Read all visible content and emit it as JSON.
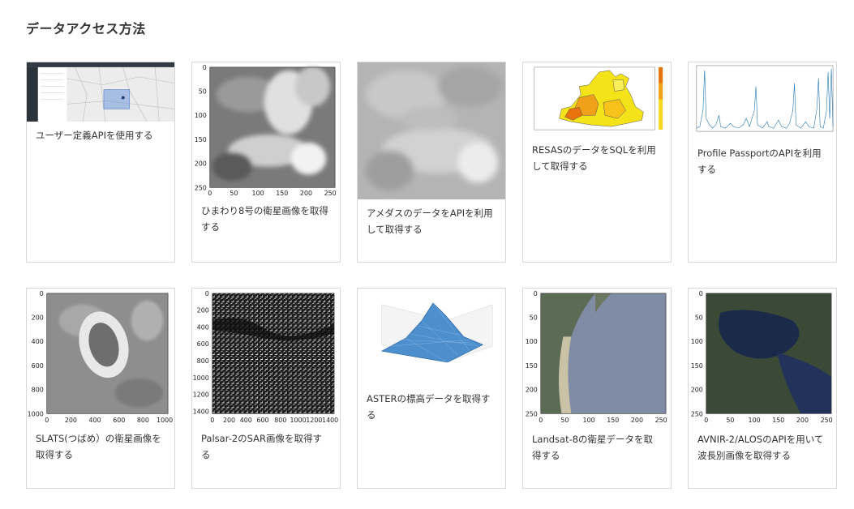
{
  "page": {
    "title": "データアクセス方法"
  },
  "cards": [
    {
      "label": "ユーザー定義APIを使用する",
      "thumbnail": "web app screenshot with sidebar and map"
    },
    {
      "label": "ひまわり8号の衛星画像を取得する",
      "thumbnail": "grayscale satellite image plot",
      "axes": {
        "x_ticks": [
          "0",
          "50",
          "100",
          "150",
          "200",
          "250"
        ],
        "y_ticks": [
          "0",
          "50",
          "100",
          "150",
          "200",
          "250"
        ]
      }
    },
    {
      "label": "アメダスのデータをAPIを利用して取得する",
      "thumbnail": "grayscale cloud satellite image"
    },
    {
      "label": "RESASのデータをSQLを利用して取得する",
      "thumbnail": "choropleth map in yellow and orange"
    },
    {
      "label": "Profile PassportのAPIを利用する",
      "thumbnail": "blue line time series chart"
    },
    {
      "label": "SLATS(つばめ）の衛星画像を取得する",
      "thumbnail": "grayscale satellite image of a stadium",
      "axes": {
        "x_ticks": [
          "0",
          "200",
          "400",
          "600",
          "800",
          "1000"
        ],
        "y_ticks": [
          "0",
          "200",
          "400",
          "600",
          "800",
          "1000"
        ]
      }
    },
    {
      "label": "Palsar-2のSAR画像を取得する",
      "thumbnail": "black and white SAR image",
      "axes": {
        "x_ticks": [
          "0",
          "200",
          "400",
          "600",
          "800",
          "1000",
          "1200",
          "1400"
        ],
        "y_ticks": [
          "0",
          "200",
          "400",
          "600",
          "800",
          "1000",
          "1200",
          "1400"
        ]
      }
    },
    {
      "label": "ASTERの標高データを取得する",
      "thumbnail": "3D blue wireframe elevation surface"
    },
    {
      "label": "Landsat-8の衛星データを取得する",
      "thumbnail": "color satellite image of coastline",
      "axes": {
        "x_ticks": [
          "0",
          "50",
          "100",
          "150",
          "200",
          "250"
        ],
        "y_ticks": [
          "0",
          "50",
          "100",
          "150",
          "200",
          "250"
        ]
      }
    },
    {
      "label": "AVNIR-2/ALOSのAPIを用いて波長別画像を取得する",
      "thumbnail": "color satellite image of a lake",
      "axes": {
        "x_ticks": [
          "0",
          "50",
          "100",
          "150",
          "200",
          "250"
        ],
        "y_ticks": [
          "0",
          "50",
          "100",
          "150",
          "200",
          "250"
        ]
      }
    }
  ]
}
